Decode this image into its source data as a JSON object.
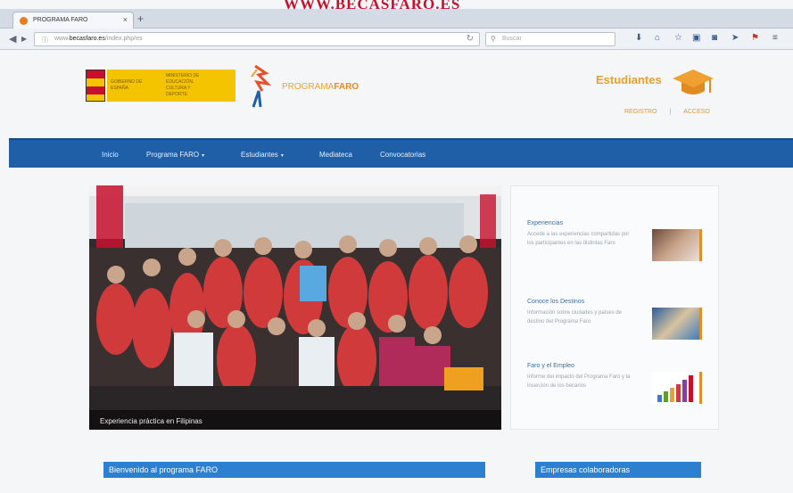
{
  "watermark": "WWW.BECASFARO.ES",
  "browser": {
    "tab_title": "PROGRAMA FARO",
    "tab_close": "×",
    "new_tab": "+",
    "url_host": "becasfaro.es",
    "url_path": "/index.php/es",
    "search_placeholder": "Buscar"
  },
  "header": {
    "gov_line1": "GOBIERNO DE ESPAÑA",
    "gov_line2": "MINISTERIO DE EDUCACIÓN, CULTURA Y DEPORTE",
    "brand_prefix": "PROGRAMA",
    "brand_suffix": "FARO",
    "students_title": "Estudiantes",
    "register_link": "REGISTRO",
    "separator": "|",
    "login_link": "ACCESO"
  },
  "menu": {
    "items": [
      {
        "label": "Inicio"
      },
      {
        "label": "Programa FARO",
        "caret": "▾"
      },
      {
        "label": "Estudiantes",
        "caret": "▾"
      },
      {
        "label": "Mediateca"
      },
      {
        "label": "Convocatorias"
      }
    ]
  },
  "hero": {
    "caption": "Experiencia práctica en Filipinas"
  },
  "side": {
    "items": [
      {
        "title": "Experiencias",
        "desc": "Accede a las experiencias compartidas por los participantes en las distintas Faro"
      },
      {
        "title": "Conoce los Destinos",
        "desc": "Información sobre ciudades y países de destino del Programa Faro"
      },
      {
        "title": "Faro y el Empleo",
        "desc": "Informe del impacto del Programa Faro y la inserción de los becarios"
      }
    ]
  },
  "bottom": {
    "welcome": "Bienvenido al programa FARO",
    "companies": "Empresas colaboradoras"
  },
  "colors": {
    "menu_blue": "#1f5fa8",
    "accent_orange": "#e8a030",
    "header_blue": "#2d7fd0"
  }
}
